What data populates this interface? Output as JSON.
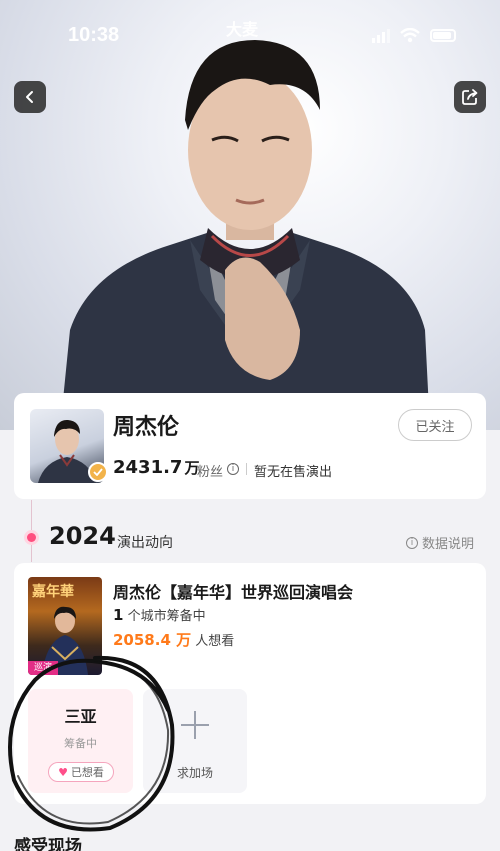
{
  "status_bar": {
    "time": "10:38",
    "center_logo": "大麦"
  },
  "nav": {
    "back_icon": "chevron-left-icon",
    "share_icon": "share-icon"
  },
  "artist": {
    "name": "周杰伦",
    "fans_count": "2431.7",
    "fans_unit": "万",
    "fans_label": "粉丝",
    "info_icon": "ⓘ",
    "on_sale_status": "暂无在售演出",
    "follow_button": "已关注",
    "badge_icon": "verified-badge-icon"
  },
  "timeline": {
    "year": "2024",
    "section_label": "演出动向",
    "data_explain": "数据说明",
    "data_explain_icon": "ⓘ"
  },
  "show": {
    "poster_title": "嘉年華",
    "poster_tag": "巡演",
    "title": "周杰伦【嘉年华】世界巡回演唱会",
    "cities_count": "1",
    "cities_text": "个城市筹备中",
    "want_count": "2058.4 万",
    "want_text": "人想看",
    "cities": [
      {
        "name": "三亚",
        "status": "筹备中",
        "want_button": "已想看"
      }
    ],
    "add_label": "求加场"
  },
  "section": {
    "title": "感受现场"
  },
  "colors": {
    "accent_pink": "#ff4f7f",
    "accent_orange": "#ff7a1a",
    "badge_gold": "#f2b34a"
  }
}
